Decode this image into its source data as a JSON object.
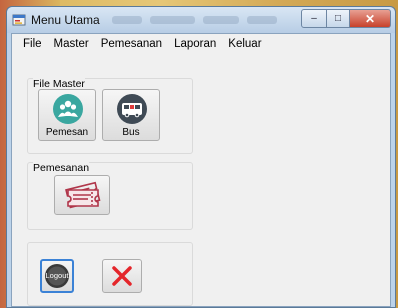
{
  "window": {
    "title": "Menu Utama",
    "controls": {
      "minimize": "‒",
      "maximize": "□",
      "close": "✕"
    }
  },
  "menu": [
    "File",
    "Master",
    "Pemesanan",
    "Laporan",
    "Keluar"
  ],
  "groups": {
    "file_master": {
      "title": "File Master",
      "buttons": [
        {
          "label": "Pemesan",
          "icon": "users-icon"
        },
        {
          "label": "Bus",
          "icon": "bus-icon"
        }
      ]
    },
    "pemesanan": {
      "title": "Pemesanan",
      "buttons": [
        {
          "icon": "ticket-icon"
        }
      ]
    },
    "actions": {
      "buttons": [
        {
          "label": "Logout",
          "icon": "logout-icon"
        },
        {
          "icon": "close-x-icon"
        }
      ]
    }
  },
  "colors": {
    "pemesan_icon": "#3aa7a0",
    "bus_icon": "#3f4a55",
    "bus_accent": "#e03b3b",
    "ticket_icon": "#b0364a",
    "close_x": "#e4262b",
    "logout_ring": "#3b82d6"
  }
}
